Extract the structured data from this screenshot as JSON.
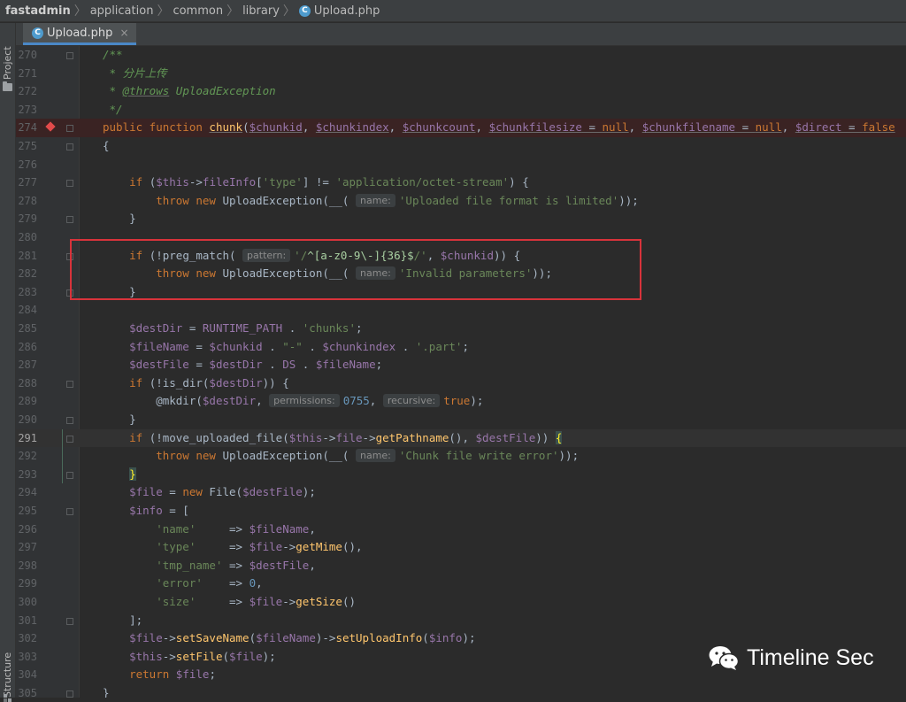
{
  "breadcrumb": [
    "fastadmin",
    "application",
    "common",
    "library",
    "Upload.php"
  ],
  "breadcrumb_separator": "〉",
  "file_icon_letter": "C",
  "left_strip": {
    "project_label": "Project",
    "structure_label": "Structure"
  },
  "tab": {
    "label": "Upload.php",
    "close": "×"
  },
  "editor": {
    "current_line": 291,
    "breakpoint_line": 274,
    "highlight_range": [
      281,
      283
    ]
  },
  "code_lines": [
    {
      "n": "270",
      "segs": [
        [
          "cmt",
          "/**"
        ]
      ]
    },
    {
      "n": "271",
      "segs": [
        [
          "cmt",
          " * 分片上传"
        ]
      ]
    },
    {
      "n": "272",
      "segs": [
        [
          "cmt",
          " * "
        ],
        [
          "cmtu",
          "@throws"
        ],
        [
          "cmt",
          " UploadException"
        ]
      ]
    },
    {
      "n": "273",
      "segs": [
        [
          "cmt",
          " */"
        ]
      ]
    },
    {
      "n": "274",
      "segs": [
        [
          "kw",
          "public function "
        ],
        [
          "fnu",
          "chunk"
        ],
        [
          "p",
          "("
        ],
        [
          "varu",
          "$chunkid"
        ],
        [
          "p",
          ", "
        ],
        [
          "varu",
          "$chunkindex"
        ],
        [
          "p",
          ", "
        ],
        [
          "varu",
          "$chunkcount"
        ],
        [
          "p",
          ", "
        ],
        [
          "varu",
          "$chunkfilesize"
        ],
        [
          "pu",
          " = "
        ],
        [
          "kwu",
          "null"
        ],
        [
          "p",
          ", "
        ],
        [
          "varu",
          "$chunkfilename"
        ],
        [
          "pu",
          " = "
        ],
        [
          "kwu",
          "null"
        ],
        [
          "p",
          ", "
        ],
        [
          "varu",
          "$direct"
        ],
        [
          "pu",
          " = "
        ],
        [
          "kwu",
          "false"
        ]
      ]
    },
    {
      "n": "275",
      "segs": [
        [
          "p",
          "{"
        ]
      ]
    },
    {
      "n": "276",
      "segs": []
    },
    {
      "n": "277",
      "segs": [
        [
          "kw",
          "    if "
        ],
        [
          "p",
          "("
        ],
        [
          "var",
          "$this"
        ],
        [
          "p",
          "->"
        ],
        [
          "var",
          "fileInfo"
        ],
        [
          "p",
          "["
        ],
        [
          "str",
          "'type'"
        ],
        [
          "p",
          "] != "
        ],
        [
          "str",
          "'application/octet-stream'"
        ],
        [
          "p",
          ") {"
        ]
      ]
    },
    {
      "n": "278",
      "segs": [
        [
          "kw",
          "        throw new "
        ],
        [
          "p",
          "UploadException(__( "
        ],
        [
          "hint",
          "name:"
        ],
        [
          "str",
          "'Uploaded file format is limited'"
        ],
        [
          "p",
          "));"
        ]
      ]
    },
    {
      "n": "279",
      "segs": [
        [
          "p",
          "    }"
        ]
      ]
    },
    {
      "n": "280",
      "segs": []
    },
    {
      "n": "281",
      "segs": [
        [
          "kw",
          "    if "
        ],
        [
          "p",
          "(!preg_match( "
        ],
        [
          "hint",
          "pattern:"
        ],
        [
          "str",
          "'/"
        ],
        [
          "rx",
          "^[a-z0-9\\-]{36}$"
        ],
        [
          "str",
          "/'"
        ],
        [
          "p",
          ", "
        ],
        [
          "var",
          "$chunkid"
        ],
        [
          "p",
          ")) {"
        ]
      ]
    },
    {
      "n": "282",
      "segs": [
        [
          "kw",
          "        throw new "
        ],
        [
          "p",
          "UploadException(__( "
        ],
        [
          "hint",
          "name:"
        ],
        [
          "str",
          "'Invalid parameters'"
        ],
        [
          "p",
          "));"
        ]
      ]
    },
    {
      "n": "283",
      "segs": [
        [
          "p",
          "    }"
        ]
      ]
    },
    {
      "n": "284",
      "segs": []
    },
    {
      "n": "285",
      "segs": [
        [
          "var",
          "    $destDir"
        ],
        [
          "p",
          " = "
        ],
        [
          "varc",
          "RUNTIME_PATH"
        ],
        [
          "p",
          " . "
        ],
        [
          "str",
          "'chunks'"
        ],
        [
          "p",
          ";"
        ]
      ]
    },
    {
      "n": "286",
      "segs": [
        [
          "var",
          "    $fileName"
        ],
        [
          "p",
          " = "
        ],
        [
          "var",
          "$chunkid"
        ],
        [
          "p",
          " . "
        ],
        [
          "str",
          "\"-\""
        ],
        [
          "p",
          " . "
        ],
        [
          "var",
          "$chunkindex"
        ],
        [
          "p",
          " . "
        ],
        [
          "str",
          "'.part'"
        ],
        [
          "p",
          ";"
        ]
      ]
    },
    {
      "n": "287",
      "segs": [
        [
          "var",
          "    $destFile"
        ],
        [
          "p",
          " = "
        ],
        [
          "var",
          "$destDir"
        ],
        [
          "p",
          " . "
        ],
        [
          "varc",
          "DS"
        ],
        [
          "p",
          " . "
        ],
        [
          "var",
          "$fileName"
        ],
        [
          "p",
          ";"
        ]
      ]
    },
    {
      "n": "288",
      "segs": [
        [
          "kw",
          "    if "
        ],
        [
          "p",
          "(!is_dir("
        ],
        [
          "var",
          "$destDir"
        ],
        [
          "p",
          ")) {"
        ]
      ]
    },
    {
      "n": "289",
      "segs": [
        [
          "p",
          "        @mkdir("
        ],
        [
          "var",
          "$destDir"
        ],
        [
          "p",
          ", "
        ],
        [
          "hint",
          "permissions:"
        ],
        [
          "num",
          "0755"
        ],
        [
          "p",
          ", "
        ],
        [
          "hint",
          "recursive:"
        ],
        [
          "kw",
          "true"
        ],
        [
          "p",
          ");"
        ]
      ]
    },
    {
      "n": "290",
      "segs": [
        [
          "p",
          "    }"
        ]
      ]
    },
    {
      "n": "291",
      "segs": [
        [
          "kw",
          "    if "
        ],
        [
          "p",
          "(!move_uploaded_file("
        ],
        [
          "var",
          "$this"
        ],
        [
          "p",
          "->"
        ],
        [
          "var",
          "file"
        ],
        [
          "p",
          "->"
        ],
        [
          "fn",
          "getPathname"
        ],
        [
          "p",
          "(), "
        ],
        [
          "var",
          "$destFile"
        ],
        [
          "p",
          ")) "
        ],
        [
          "bhl",
          "{"
        ]
      ]
    },
    {
      "n": "292",
      "segs": [
        [
          "kw",
          "        throw new "
        ],
        [
          "p",
          "UploadException(__( "
        ],
        [
          "hint",
          "name:"
        ],
        [
          "str",
          "'Chunk file write error'"
        ],
        [
          "p",
          "));"
        ]
      ]
    },
    {
      "n": "293",
      "segs": [
        [
          "p",
          "    "
        ],
        [
          "bhl",
          "}"
        ]
      ]
    },
    {
      "n": "294",
      "segs": [
        [
          "var",
          "    $file"
        ],
        [
          "p",
          " = "
        ],
        [
          "kw",
          "new "
        ],
        [
          "p",
          "File("
        ],
        [
          "var",
          "$destFile"
        ],
        [
          "p",
          ");"
        ]
      ]
    },
    {
      "n": "295",
      "segs": [
        [
          "var",
          "    $info"
        ],
        [
          "p",
          " = ["
        ]
      ]
    },
    {
      "n": "296",
      "segs": [
        [
          "str",
          "        'name'"
        ],
        [
          "p",
          "     => "
        ],
        [
          "var",
          "$fileName"
        ],
        [
          "p",
          ","
        ]
      ]
    },
    {
      "n": "297",
      "segs": [
        [
          "str",
          "        'type'"
        ],
        [
          "p",
          "     => "
        ],
        [
          "var",
          "$file"
        ],
        [
          "p",
          "->"
        ],
        [
          "fn",
          "getMime"
        ],
        [
          "p",
          "(),"
        ]
      ]
    },
    {
      "n": "298",
      "segs": [
        [
          "str",
          "        'tmp_name'"
        ],
        [
          "p",
          " => "
        ],
        [
          "var",
          "$destFile"
        ],
        [
          "p",
          ","
        ]
      ]
    },
    {
      "n": "299",
      "segs": [
        [
          "str",
          "        'error'"
        ],
        [
          "p",
          "    => "
        ],
        [
          "num",
          "0"
        ],
        [
          "p",
          ","
        ]
      ]
    },
    {
      "n": "300",
      "segs": [
        [
          "str",
          "        'size'"
        ],
        [
          "p",
          "     => "
        ],
        [
          "var",
          "$file"
        ],
        [
          "p",
          "->"
        ],
        [
          "fn",
          "getSize"
        ],
        [
          "p",
          "()"
        ]
      ]
    },
    {
      "n": "301",
      "segs": [
        [
          "p",
          "    ];"
        ]
      ]
    },
    {
      "n": "302",
      "segs": [
        [
          "var",
          "    $file"
        ],
        [
          "p",
          "->"
        ],
        [
          "fn",
          "setSaveName"
        ],
        [
          "p",
          "("
        ],
        [
          "var",
          "$fileName"
        ],
        [
          "p",
          ")->"
        ],
        [
          "fn",
          "setUploadInfo"
        ],
        [
          "p",
          "("
        ],
        [
          "var",
          "$info"
        ],
        [
          "p",
          ");"
        ]
      ]
    },
    {
      "n": "303",
      "segs": [
        [
          "var",
          "    $this"
        ],
        [
          "p",
          "->"
        ],
        [
          "fn",
          "setFile"
        ],
        [
          "p",
          "("
        ],
        [
          "var",
          "$file"
        ],
        [
          "p",
          ");"
        ]
      ]
    },
    {
      "n": "304",
      "segs": [
        [
          "kw",
          "    return "
        ],
        [
          "var",
          "$file"
        ],
        [
          "p",
          ";"
        ]
      ]
    },
    {
      "n": "305",
      "segs": [
        [
          "p",
          "}"
        ]
      ]
    }
  ],
  "watermark": {
    "text": "Timeline Sec"
  },
  "colors": {
    "background": "#2b2b2b",
    "gutter": "#313335",
    "keyword": "#cc7832",
    "variable": "#9876aa",
    "string": "#6a8759",
    "number": "#6897bb",
    "comment": "#629755",
    "method": "#ffc66d",
    "highlight_box": "#d8333b",
    "breakpoint": "#e24b4b"
  }
}
